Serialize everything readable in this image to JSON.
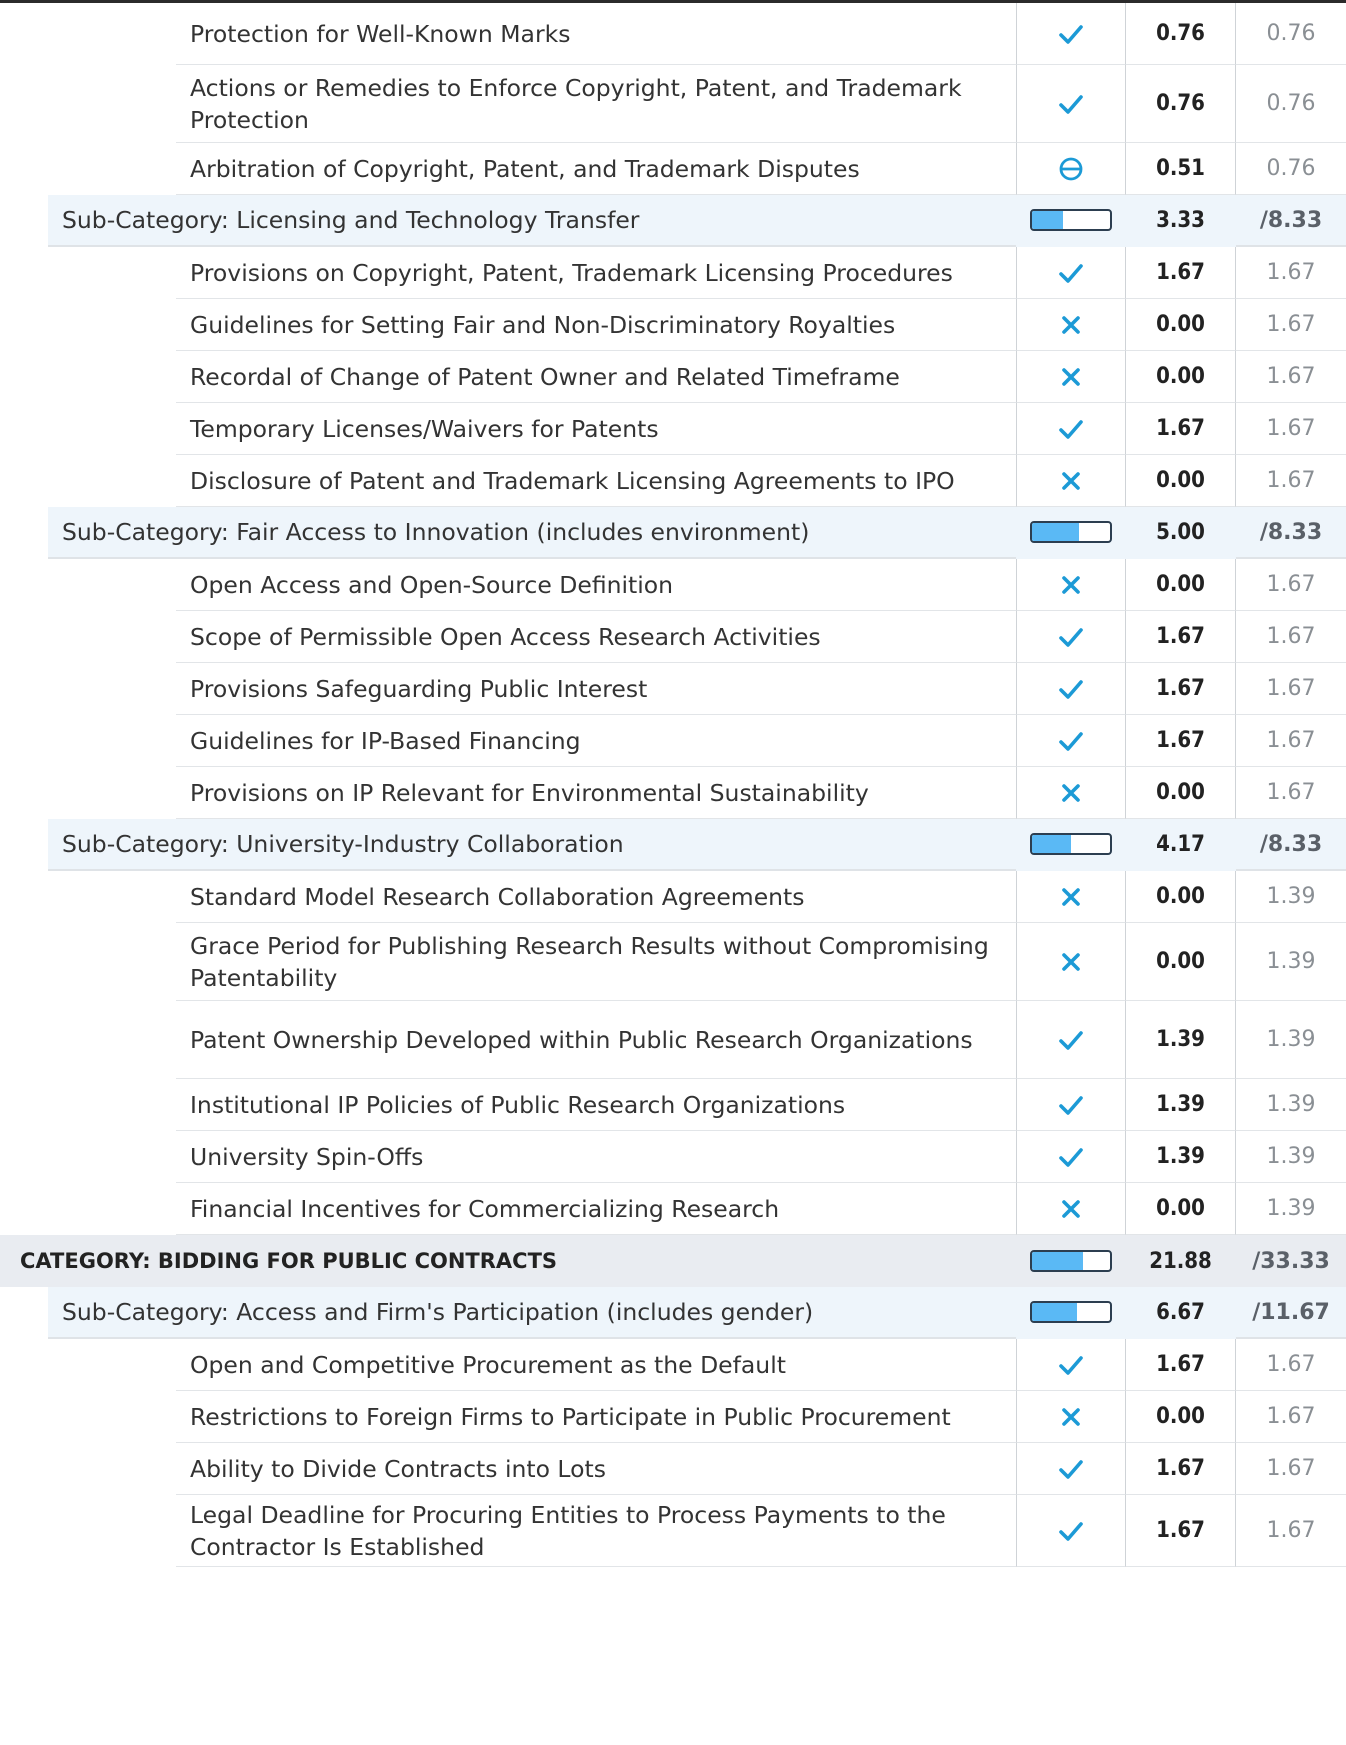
{
  "colors": {
    "accent": "#1c9ad6",
    "bar_fill": "#5ab9f5",
    "sub_bg": "#eef5fb",
    "cat_bg": "#e9ecf1"
  },
  "rows": [
    {
      "kind": "item",
      "label": "Protection for Well-Known Marks",
      "status": "check",
      "score": "0.76",
      "max": "0.76"
    },
    {
      "kind": "item",
      "label": "Actions or Remedies to Enforce Copyright, Patent, and Trademark Protection",
      "status": "check",
      "score": "0.76",
      "max": "0.76"
    },
    {
      "kind": "item",
      "label": "Arbitration of Copyright, Patent, and Trademark Disputes",
      "status": "partial",
      "score": "0.51",
      "max": "0.76"
    },
    {
      "kind": "sub",
      "label": "Sub-Category: Licensing and Technology Transfer",
      "progress": 0.4,
      "score": "3.33",
      "max": "/8.33"
    },
    {
      "kind": "item",
      "label": "Provisions on Copyright, Patent, Trademark Licensing Procedures",
      "status": "check",
      "score": "1.67",
      "max": "1.67"
    },
    {
      "kind": "item",
      "label": "Guidelines for Setting Fair and Non-Discriminatory Royalties",
      "status": "cross",
      "score": "0.00",
      "max": "1.67"
    },
    {
      "kind": "item",
      "label": "Recordal of Change of Patent Owner and Related Timeframe",
      "status": "cross",
      "score": "0.00",
      "max": "1.67"
    },
    {
      "kind": "item",
      "label": "Temporary Licenses/Waivers for Patents",
      "status": "check",
      "score": "1.67",
      "max": "1.67"
    },
    {
      "kind": "item",
      "label": "Disclosure of Patent and Trademark Licensing Agreements to IPO",
      "status": "cross",
      "score": "0.00",
      "max": "1.67"
    },
    {
      "kind": "sub",
      "label": "Sub-Category: Fair Access to Innovation (includes environment)",
      "progress": 0.6,
      "score": "5.00",
      "max": "/8.33"
    },
    {
      "kind": "item",
      "label": "Open Access and Open-Source Definition",
      "status": "cross",
      "score": "0.00",
      "max": "1.67"
    },
    {
      "kind": "item",
      "label": "Scope of Permissible Open Access Research Activities",
      "status": "check",
      "score": "1.67",
      "max": "1.67"
    },
    {
      "kind": "item",
      "label": "Provisions Safeguarding Public Interest",
      "status": "check",
      "score": "1.67",
      "max": "1.67"
    },
    {
      "kind": "item",
      "label": "Guidelines for IP-Based Financing",
      "status": "check",
      "score": "1.67",
      "max": "1.67"
    },
    {
      "kind": "item",
      "label": "Provisions on IP Relevant for Environmental Sustainability",
      "status": "cross",
      "score": "0.00",
      "max": "1.67"
    },
    {
      "kind": "sub",
      "label": "Sub-Category: University-Industry Collaboration",
      "progress": 0.5,
      "score": "4.17",
      "max": "/8.33"
    },
    {
      "kind": "item",
      "label": "Standard Model Research Collaboration Agreements",
      "status": "cross",
      "score": "0.00",
      "max": "1.39"
    },
    {
      "kind": "item",
      "label": "Grace Period for Publishing Research Results without Compromising Patentability",
      "status": "cross",
      "score": "0.00",
      "max": "1.39"
    },
    {
      "kind": "item",
      "label": "Patent Ownership Developed within Public Research Organizations",
      "status": "check",
      "score": "1.39",
      "max": "1.39"
    },
    {
      "kind": "item",
      "label": "Institutional IP Policies of Public Research Organizations",
      "status": "check",
      "score": "1.39",
      "max": "1.39"
    },
    {
      "kind": "item",
      "label": "University Spin-Offs",
      "status": "check",
      "score": "1.39",
      "max": "1.39"
    },
    {
      "kind": "item",
      "label": "Financial Incentives for Commercializing Research",
      "status": "cross",
      "score": "0.00",
      "max": "1.39"
    },
    {
      "kind": "cat",
      "label": "CATEGORY: BIDDING FOR PUBLIC CONTRACTS",
      "progress": 0.656,
      "score": "21.88",
      "max": "/33.33"
    },
    {
      "kind": "sub",
      "label": "Sub-Category: Access and Firm's Participation (includes gender)",
      "progress": 0.571,
      "score": "6.67",
      "max": "/11.67"
    },
    {
      "kind": "item",
      "label": "Open and Competitive Procurement as the Default",
      "status": "check",
      "score": "1.67",
      "max": "1.67"
    },
    {
      "kind": "item",
      "label": "Restrictions to Foreign Firms to Participate in Public Procurement",
      "status": "cross",
      "score": "0.00",
      "max": "1.67"
    },
    {
      "kind": "item",
      "label": "Ability to Divide Contracts into Lots",
      "status": "check",
      "score": "1.67",
      "max": "1.67"
    },
    {
      "kind": "item",
      "label": "Legal Deadline for Procuring Entities to Process Payments to the Contractor Is Established",
      "status": "check",
      "score": "1.67",
      "max": "1.67"
    }
  ]
}
